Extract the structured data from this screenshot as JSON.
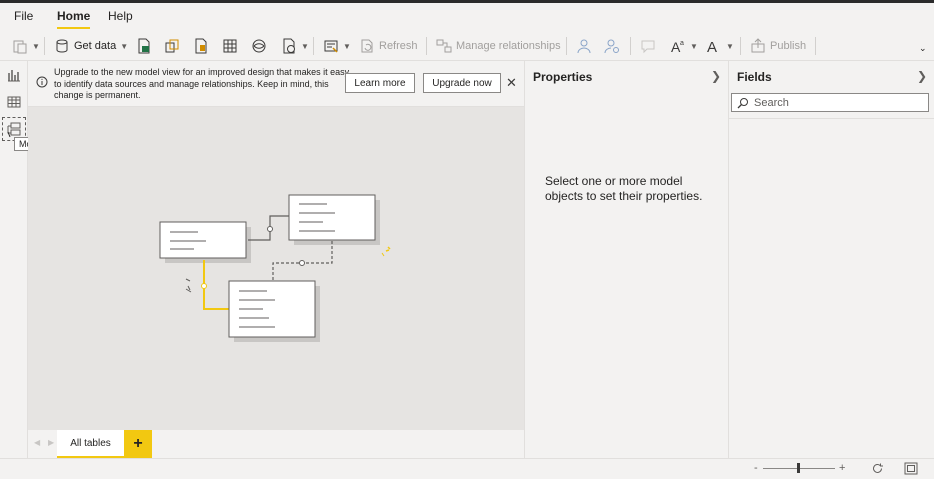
{
  "menu": {
    "tabs": [
      {
        "label": "File"
      },
      {
        "label": "Home"
      },
      {
        "label": "Help"
      }
    ]
  },
  "ribbon": {
    "get_data": "Get data",
    "refresh": "Refresh",
    "manage_relationships": "Manage relationships",
    "publish": "Publish"
  },
  "left_rail": {
    "tooltip": "Model"
  },
  "banner": {
    "message": "Upgrade to the new model view for an improved design that makes it easy to identify data sources and manage relationships. Keep in mind, this change is permanent.",
    "learn_more": "Learn more",
    "upgrade_now": "Upgrade now"
  },
  "bottom_tabs": {
    "all_tables": "All tables",
    "add_label": "+"
  },
  "properties": {
    "title": "Properties",
    "empty_message": "Select one or more model objects to set their properties."
  },
  "fields": {
    "title": "Fields",
    "search_placeholder": "Search"
  },
  "status_bar": {
    "zoom_minus": "-",
    "zoom_plus": "+"
  },
  "colors": {
    "accent": "#f2c811",
    "background": "#f3f2f1",
    "canvas": "#e6e4e2"
  },
  "icons": [
    "paste-icon",
    "get-data-icon",
    "excel-icon",
    "dataset-icon",
    "dataverse-icon",
    "table-icon",
    "sql-icon",
    "recent-sources-icon",
    "transform-icon",
    "refresh-icon",
    "manage-relationships-icon",
    "manage-roles-icon",
    "view-as-icon",
    "q-and-a-icon",
    "language-icon",
    "linguistic-schema-icon",
    "publish-icon",
    "report-view-icon",
    "data-view-icon",
    "model-view-icon",
    "info-icon",
    "close-icon",
    "search-icon",
    "chevron-right-icon",
    "reset-zoom-icon",
    "fit-to-page-icon"
  ]
}
